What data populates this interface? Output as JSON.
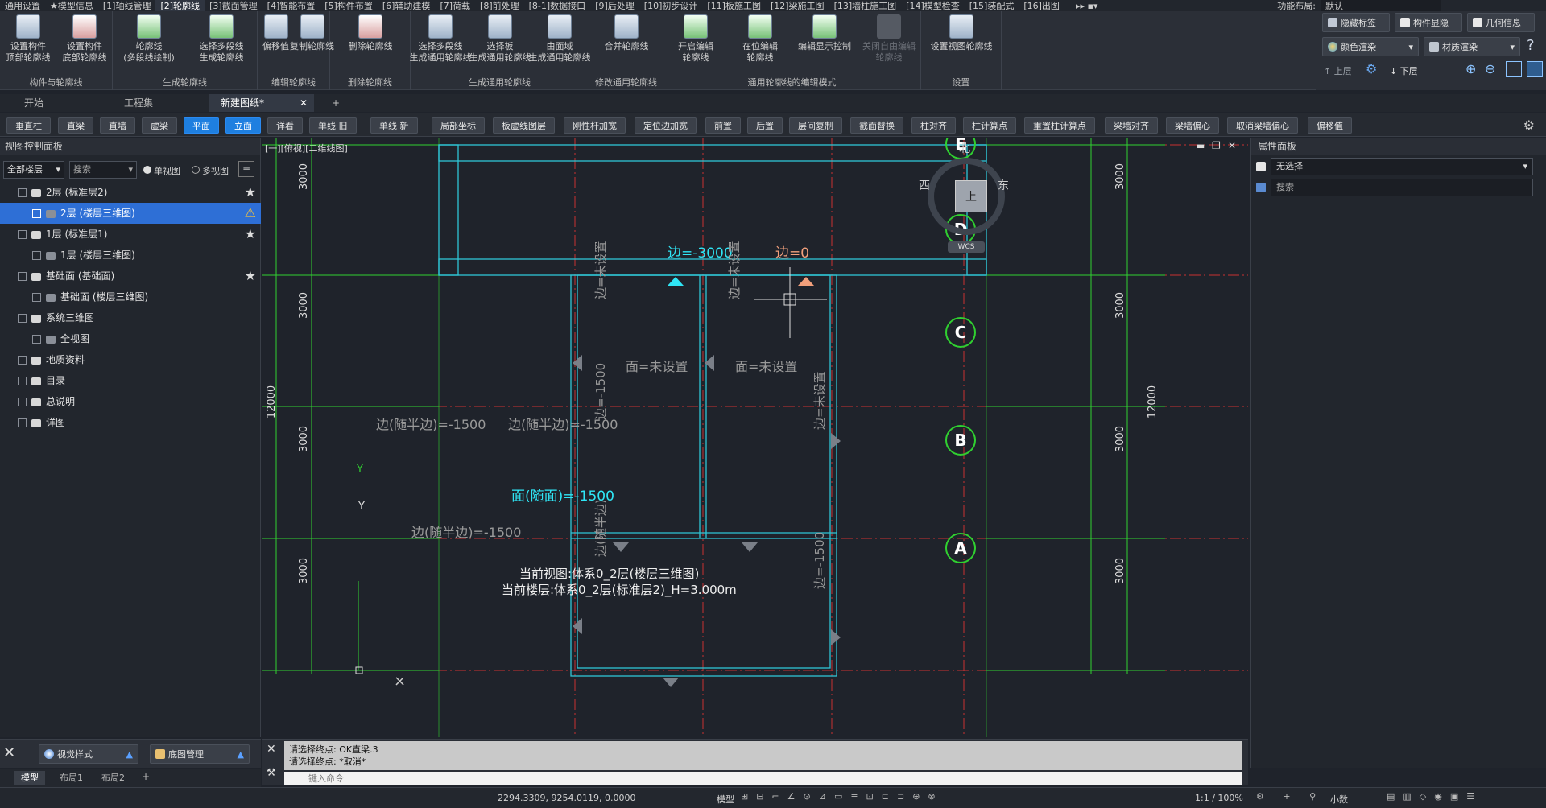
{
  "menubar": {
    "items": [
      "通用设置",
      "★模型信息",
      "[1]轴线管理",
      "[2]轮廓线",
      "[3]截面管理",
      "[4]智能布置",
      "[5]构件布置",
      "[6]辅助建模",
      "[7]荷载",
      "[8]前处理",
      "[8-1]数据接口",
      "[9]后处理",
      "[10]初步设计",
      "[11]板施工图",
      "[12]梁施工图",
      "[13]墙柱施工图",
      "[14]模型检查",
      "[15]装配式",
      "[16]出图"
    ],
    "active_index": 3,
    "layout_label": "功能布局:",
    "layout_value": "默认"
  },
  "ribbon": {
    "groups": [
      {
        "label": "构件与轮廓线",
        "buttons": [
          "设置构件\n顶部轮廓线",
          "设置构件\n底部轮廓线"
        ]
      },
      {
        "label": "生成轮廓线",
        "buttons": [
          "轮廓线\n(多段线绘制)",
          "选择多段线\n生成轮廓线"
        ]
      },
      {
        "label": "编辑轮廓线",
        "buttons": [
          "偏移值",
          "复制轮廓线"
        ]
      },
      {
        "label": "删除轮廓线",
        "buttons": [
          "删除轮廓线"
        ]
      },
      {
        "label": "生成通用轮廓线",
        "buttons": [
          "选择多段线\n生成通用轮廓线",
          "选择板\n生成通用轮廓线",
          "由面域\n生成通用轮廓线"
        ]
      },
      {
        "label": "修改通用轮廓线",
        "buttons": [
          "合并轮廓线"
        ]
      },
      {
        "label": "通用轮廓线的编辑模式",
        "buttons": [
          "开启编辑\n轮廓线",
          "在位编辑\n轮廓线",
          "编辑显示控制",
          "关闭自由编辑\n轮廓线"
        ]
      },
      {
        "label": "设置",
        "buttons": [
          "设置视图轮廓线"
        ]
      }
    ],
    "right": {
      "hide_label": "隐藏标签",
      "component_show": "构件显隐",
      "geometry_info": "几何信息",
      "color_render": "颜色渲染",
      "material_render": "材质渲染",
      "up_floor": "上层",
      "down_floor": "下层"
    }
  },
  "tabs": {
    "items": [
      "开始",
      "工程集",
      "新建图纸*"
    ],
    "active_index": 2
  },
  "toolbar2": {
    "buttons": [
      "垂直柱",
      "直梁",
      "直墙",
      "虚梁",
      "平面",
      "立面",
      "详看",
      "单线 旧",
      "单线 新",
      "局部坐标",
      "板虚线图层",
      "刚性杆加宽",
      "定位边加宽",
      "前置",
      "后置",
      "层间复制",
      "截面替换",
      "柱对齐",
      "柱计算点",
      "重置柱计算点",
      "梁墙对齐",
      "梁墙偏心",
      "取消梁墙偏心",
      "偏移值"
    ],
    "active": [
      "平面",
      "立面"
    ]
  },
  "left_panel": {
    "title": "视图控制面板",
    "floor_select": "全部楼层",
    "search_placeholder": "搜索",
    "single_view": "单视图",
    "multi_view": "多视图",
    "tree": [
      {
        "label": "2层 (标准层2)",
        "level": 1,
        "star": true
      },
      {
        "label": "2层 (楼层三维图)",
        "level": 2,
        "selected": true
      },
      {
        "label": "1层 (标准层1)",
        "level": 1,
        "star": true
      },
      {
        "label": "1层 (楼层三维图)",
        "level": 2
      },
      {
        "label": "基础面 (基础面)",
        "level": 1,
        "star": true
      },
      {
        "label": "基础面 (楼层三维图)",
        "level": 2
      },
      {
        "label": "系统三维图",
        "level": 1
      },
      {
        "label": "全视图",
        "level": 2
      },
      {
        "label": "地质资料",
        "level": 1
      },
      {
        "label": "目录",
        "level": 1
      },
      {
        "label": "总说明",
        "level": 1
      },
      {
        "label": "详图",
        "level": 1
      }
    ],
    "bottom": {
      "visual_style": "视觉样式",
      "base_map": "底图管理"
    }
  },
  "canvas": {
    "view_label": "[一][俯视][二维线图]",
    "axes_right": [
      "E",
      "D",
      "C",
      "B",
      "A"
    ],
    "dims": [
      "3000",
      "3000",
      "3000",
      "3000"
    ],
    "total_dim": "12000",
    "compass": {
      "north": "北",
      "west": "西",
      "east": "东",
      "center": "上",
      "wcs": "WCS"
    },
    "labels": {
      "edge_minus3000": "边=-3000",
      "edge_zero": "边=0",
      "edge_unset": "边=未设置",
      "face_unset": "面=未设置",
      "edge_half_minus1500": "边(随半边)=-1500",
      "face_follow_minus1500": "面(随面)=-1500",
      "edge_minus1500": "边=-1500",
      "edge_follow": "边(随半边)",
      "y": "Y"
    },
    "current_view": "当前视图:体系0_2层(楼层三维图)",
    "current_floor": "当前楼层:体系0_2层(标准层2)_H=3.000m"
  },
  "right_panel": {
    "title": "属性面板",
    "no_selection": "无选择",
    "search_placeholder": "搜索"
  },
  "command": {
    "lines": [
      "请选择终点:  OK直梁.3",
      "请选择终点: *取消*"
    ],
    "placeholder": "键入命令"
  },
  "bottom_tabs": [
    "模型",
    "布局1",
    "布局2"
  ],
  "status": {
    "coords": "2294.3309, 9254.0119, 0.0000",
    "model": "模型",
    "scale": "1:1 / 100%",
    "decimal": "小数"
  }
}
